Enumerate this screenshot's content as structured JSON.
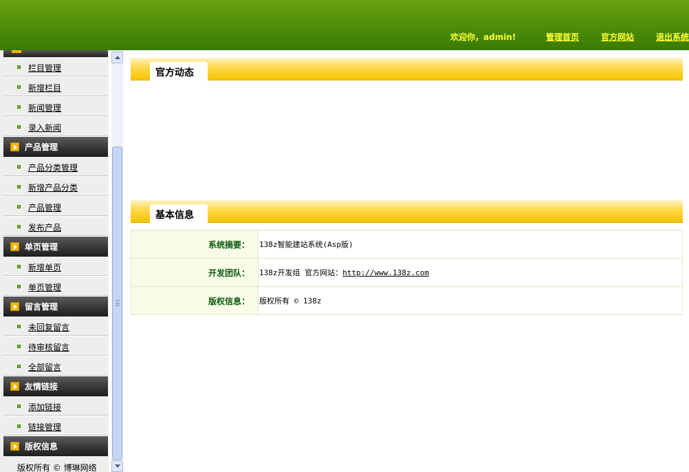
{
  "header": {
    "welcome": "欢迎你，admin!",
    "links": [
      "管理首页",
      "官方网站",
      "退出系统"
    ]
  },
  "sidebar": {
    "groups": [
      {
        "title": null,
        "items": [
          "栏目管理",
          "新增栏目",
          "新闻管理",
          "录入新闻"
        ]
      },
      {
        "title": "产品管理",
        "items": [
          "产品分类管理",
          "新增产品分类",
          "产品管理",
          "发布产品"
        ]
      },
      {
        "title": "单页管理",
        "items": [
          "新增单页",
          "单页管理"
        ]
      },
      {
        "title": "留言管理",
        "items": [
          "未回复留言",
          "待审核留言",
          "全部留言"
        ]
      },
      {
        "title": "友情链接",
        "items": [
          "添加链接",
          "链接管理"
        ]
      },
      {
        "title": "版权信息",
        "items": []
      }
    ],
    "footer": "版权所有 © 博琳网络"
  },
  "main": {
    "news_panel_title": "官方动态",
    "info_panel_title": "基本信息",
    "info": {
      "summary_label": "系统摘要：",
      "summary_value": "138z智能建站系统(Asp版)",
      "team_label": "开发团队：",
      "team_prefix": "138z开发组 官方网站：",
      "team_link": "http://www.138z.com",
      "copyright_label": "版权信息：",
      "copyright_value": "版权所有 © 138z"
    }
  },
  "colors": {
    "header_green": "#4c8c08",
    "header_text": "#ffff33",
    "panel_yellow": "#ffd84a",
    "label_green": "#0f5a0f"
  }
}
